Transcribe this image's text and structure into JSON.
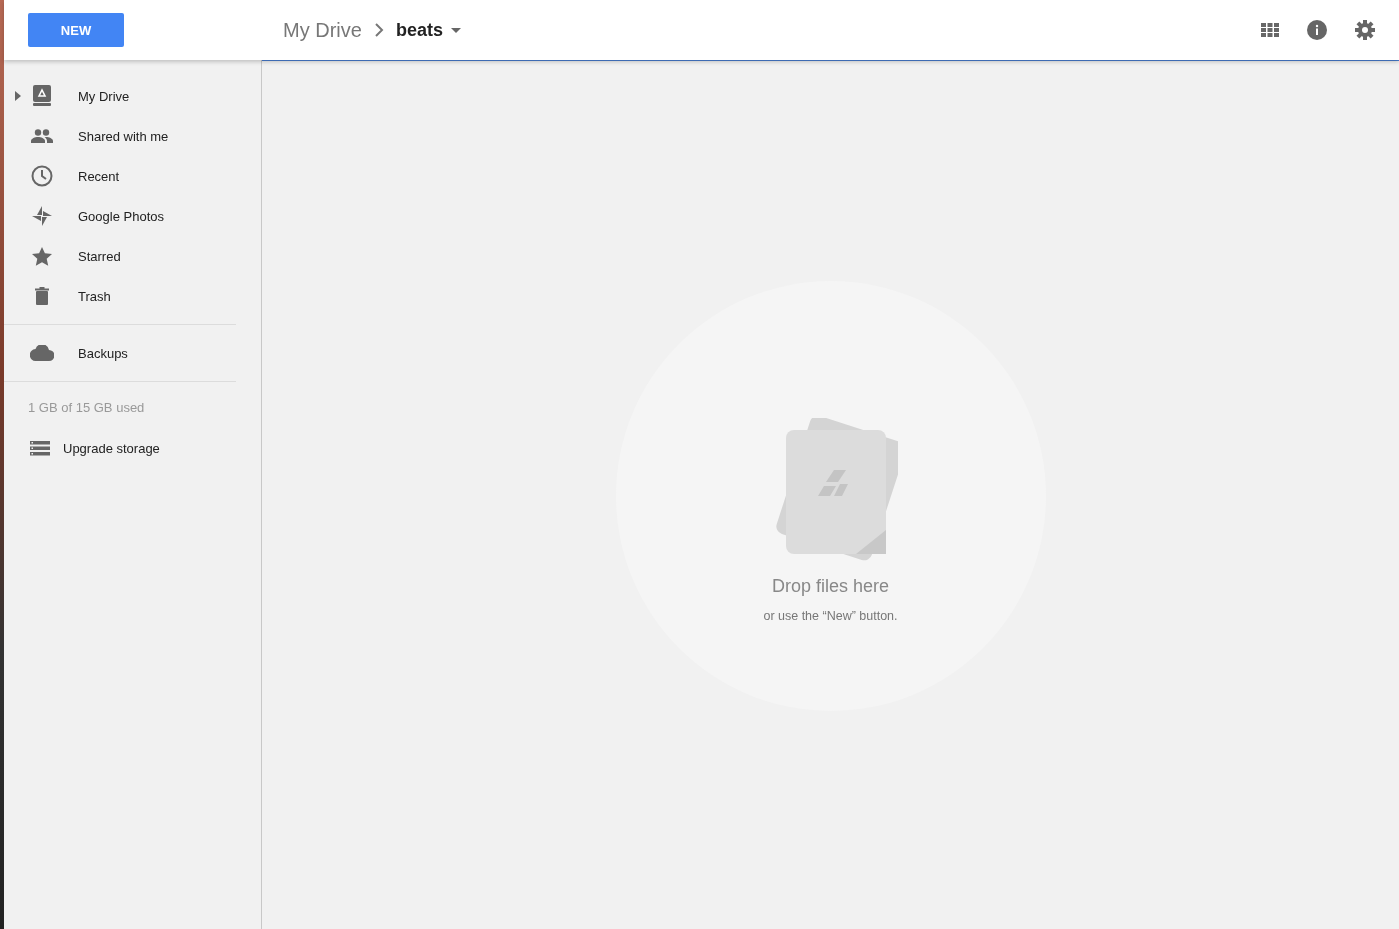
{
  "header": {
    "new_button": "NEW",
    "breadcrumb": [
      {
        "label": "My Drive",
        "current": false
      },
      {
        "label": "beats",
        "current": true
      }
    ]
  },
  "sidebar": {
    "sections": [
      {
        "items": [
          {
            "label": "My Drive",
            "kind": "drive",
            "expanded": false
          },
          {
            "label": "Shared with me",
            "kind": "shared"
          },
          {
            "label": "Recent",
            "kind": "recent"
          },
          {
            "label": "Google Photos",
            "kind": "photos"
          },
          {
            "label": "Starred",
            "kind": "starred"
          },
          {
            "label": "Trash",
            "kind": "trash"
          }
        ]
      },
      {
        "items": [
          {
            "label": "Backups",
            "kind": "backups"
          }
        ]
      }
    ],
    "storage": "1 GB of 15 GB used",
    "upgrade": "Upgrade storage"
  },
  "empty_state": {
    "title": "Drop files here",
    "subtitle": "or use the “New” button."
  }
}
